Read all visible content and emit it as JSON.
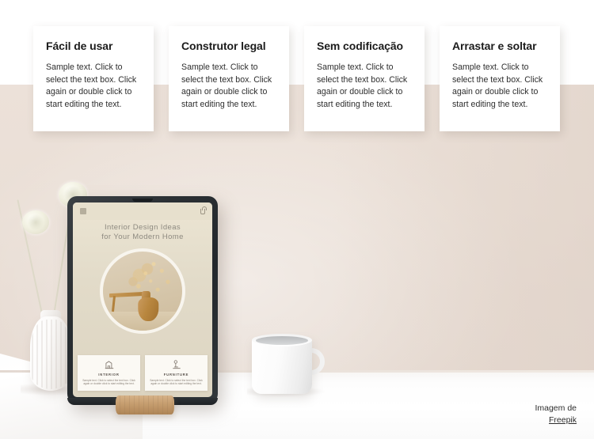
{
  "features": {
    "cards": [
      {
        "title": "Fácil de usar",
        "body": "Sample text. Click to select the text box. Click again or double click to start editing the text."
      },
      {
        "title": "Construtor legal",
        "body": "Sample text. Click to select the text box. Click again or double click to start editing the text."
      },
      {
        "title": "Sem codificação",
        "body": "Sample text. Click to select the text box. Click again or double click to start editing the text."
      },
      {
        "title": "Arrastar e soltar",
        "body": "Sample text. Click to select the text box. Click again or double click to start editing the text."
      }
    ]
  },
  "photo": {
    "tablet": {
      "topbar": {
        "menu_icon": "hamburger-menu-icon",
        "bag_icon": "shopping-bag-icon"
      },
      "headline_line1": "Interior Design Ideas",
      "headline_line2": "for Your Modern Home",
      "hero_image_alt": "terracotta-vase-with-dried-flowers",
      "cards": [
        {
          "icon": "interior-room-icon",
          "title": "INTERIOR",
          "body": "Sample text. Click to select the text box. Click again or double click to start editing the text."
        },
        {
          "icon": "furniture-lamp-icon",
          "title": "FURNITURE",
          "body": "Sample text. Click to select the text box. Click again or double click to start editing the text."
        }
      ]
    },
    "objects": {
      "vase_alt": "white-fluted-vase-with-allium-flowers",
      "mug_alt": "white-ceramic-mug",
      "stand_alt": "wooden-tablet-stand"
    }
  },
  "credit": {
    "prefix": "Imagem de",
    "link": "Freepik"
  },
  "colors": {
    "wall": "#ece1d9",
    "desk": "#ffffff",
    "card_bg": "#ffffff",
    "title_text": "#1c1c1c",
    "body_text": "#2e2e2e",
    "tablet_frame": "#2b3034",
    "tablet_screen": "#e7e0cd"
  }
}
